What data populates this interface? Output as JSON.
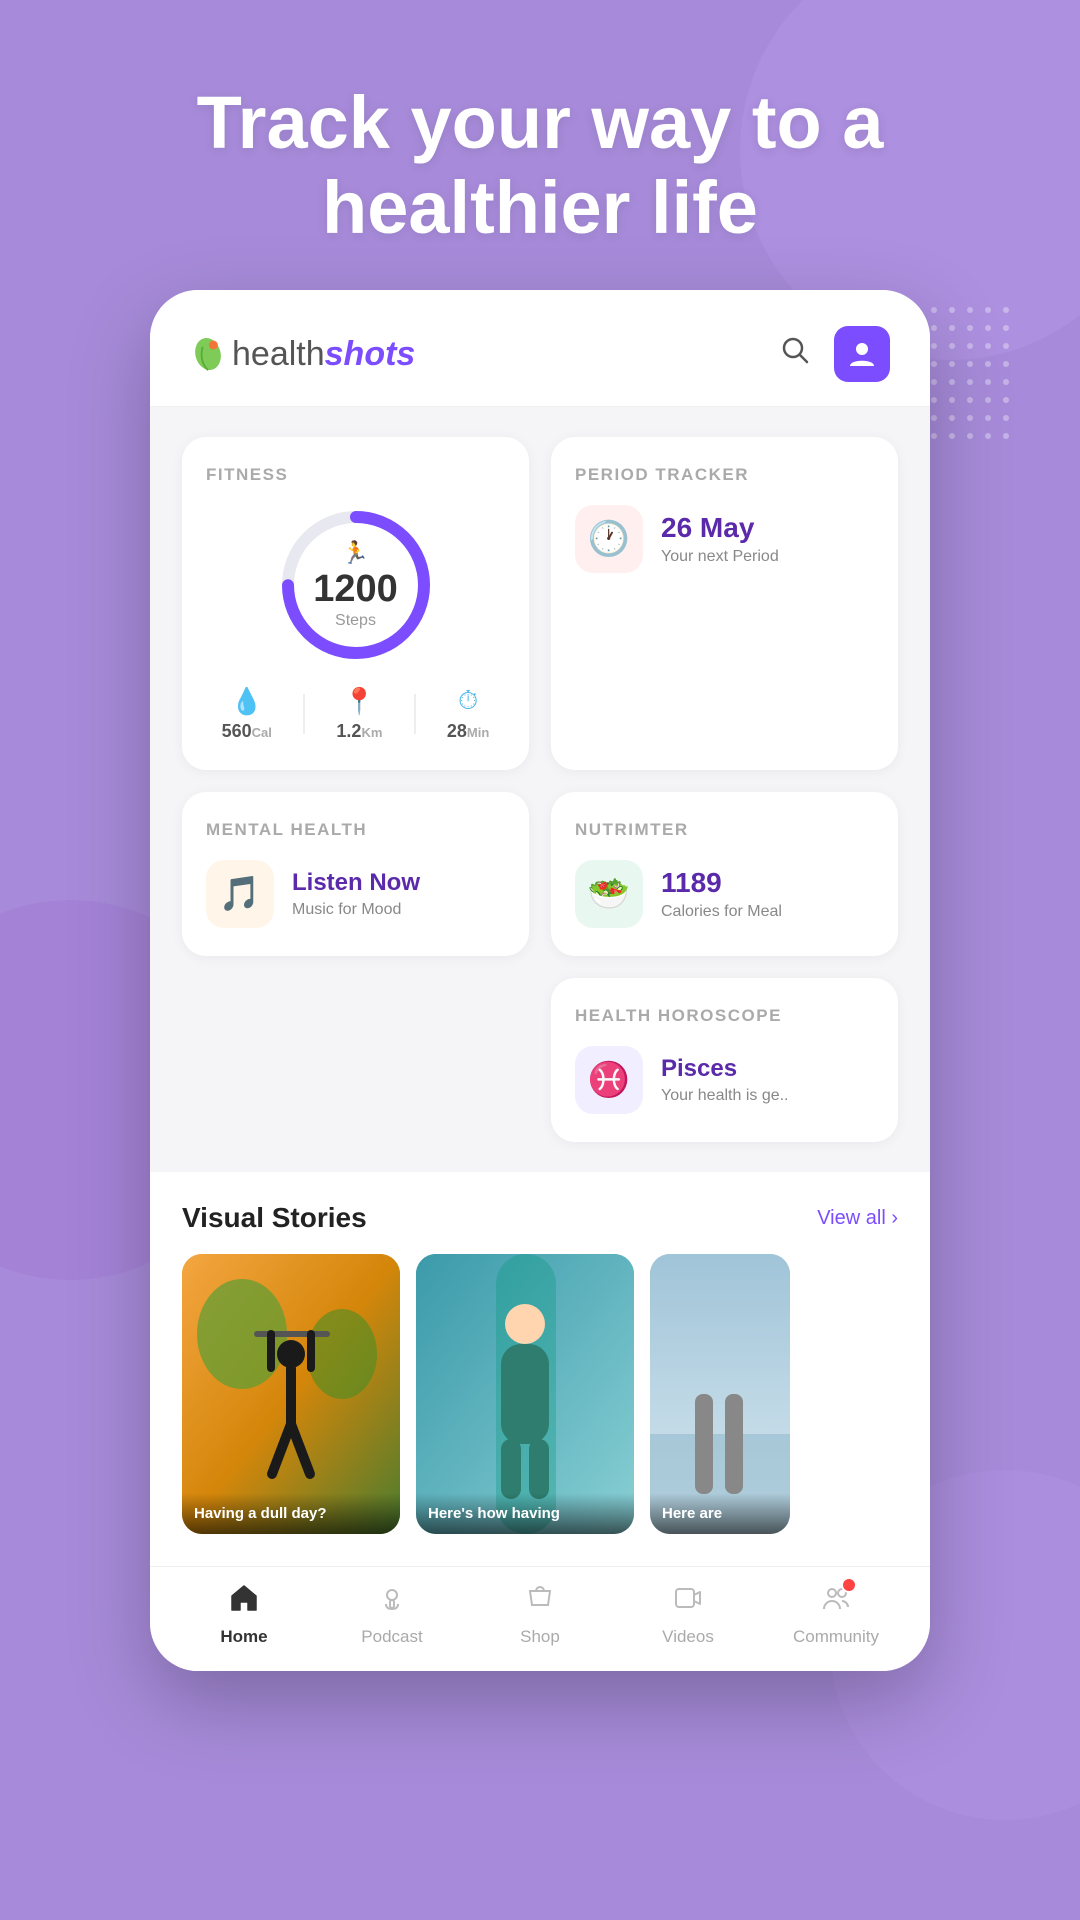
{
  "header_title": "Track your way to a healthier life",
  "app": {
    "logo_health": "health",
    "logo_shots": "shots"
  },
  "fitness": {
    "label": "FITNESS",
    "steps_count": "1200",
    "steps_label": "Steps",
    "cal_value": "560",
    "cal_unit": "Cal",
    "km_value": "1.2",
    "km_unit": "Km",
    "min_value": "28",
    "min_unit": "Min"
  },
  "period_tracker": {
    "label": "PERIOD TRACKER",
    "date": "26 May",
    "description": "Your next Period"
  },
  "nutrimter": {
    "label": "NUTRIMTER",
    "calories": "1189",
    "description": "Calories for Meal"
  },
  "mental_health": {
    "label": "MENTAL HEALTH",
    "title": "Listen Now",
    "description": "Music for Mood"
  },
  "health_horoscope": {
    "label": "HEALTH HOROSCOPE",
    "title": "Pisces",
    "description": "Your health is ge.."
  },
  "visual_stories": {
    "title": "Visual Stories",
    "view_all": "View all",
    "stories": [
      {
        "caption": "Having a dull day?"
      },
      {
        "caption": "Here's how having"
      },
      {
        "caption": "Here are"
      }
    ]
  },
  "bottom_nav": {
    "items": [
      {
        "label": "Home",
        "active": true
      },
      {
        "label": "Podcast",
        "active": false
      },
      {
        "label": "Shop",
        "active": false
      },
      {
        "label": "Videos",
        "active": false
      },
      {
        "label": "Community",
        "active": false,
        "badge": true
      }
    ]
  }
}
